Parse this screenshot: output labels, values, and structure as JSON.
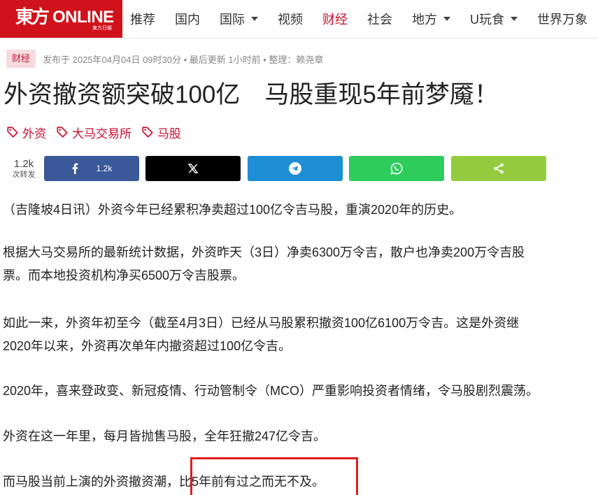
{
  "header": {
    "logo": {
      "cn": "東方",
      "en": "ONLINE",
      "sub": "東方日報"
    },
    "nav": [
      {
        "label": "推荐",
        "dropdown": false,
        "active": false
      },
      {
        "label": "国内",
        "dropdown": false,
        "active": false
      },
      {
        "label": "国际",
        "dropdown": true,
        "active": false
      },
      {
        "label": "视频",
        "dropdown": false,
        "active": false
      },
      {
        "label": "财经",
        "dropdown": false,
        "active": true
      },
      {
        "label": "社会",
        "dropdown": false,
        "active": false
      },
      {
        "label": "地方",
        "dropdown": true,
        "active": false
      },
      {
        "label": "U玩食",
        "dropdown": true,
        "active": false
      },
      {
        "label": "世界万象",
        "dropdown": false,
        "active": false
      }
    ]
  },
  "article": {
    "category": "财经",
    "meta": "发布于 2025年04月04日 09时30分 • 最后更新 1小时前 • 整理：赖尧章",
    "title": "外资撤资额突破100亿　马股重现5年前梦魇！",
    "tags": [
      "外资",
      "大马交易所",
      "马股"
    ],
    "share": {
      "count": "1.2k",
      "count_label": "次转发",
      "facebook_count": "1.2k",
      "buttons": [
        "facebook",
        "x",
        "telegram",
        "whatsapp",
        "share"
      ]
    },
    "paragraphs": [
      [
        "（吉隆坡4日讯）外资今年已经累积净卖超过100亿令吉马股，重演2020年的历史。"
      ],
      [
        "根据大马交易所的最新统计数据，外资昨天（3日）净卖6300万令吉，散户也净卖200万令吉股",
        "票。而本地投资机构净买6500万令吉股票。"
      ],
      [
        "如此一来，外资年初至今（截至4月3日）已经从马股累积撤资100亿6100万令吉。这是外资继",
        "2020年以来，外资再次单年内撤资超过100亿令吉。"
      ],
      [
        "2020年，喜来登政变、新冠疫情、行动管制令（MCO）严重影响投资者情绪，令马股剧烈震荡。"
      ],
      [
        "外资在这一年里，每月皆抛售马股，全年狂撤247亿令吉。"
      ],
      [
        "而马股当前上演的外资撤资潮，比5年前有过之而无不及。"
      ]
    ]
  },
  "colors": {
    "brand_red": "#d0121b",
    "accent_red": "#c8102e",
    "facebook": "#3b5998",
    "x": "#000000",
    "telegram": "#1d8ed4",
    "whatsapp": "#2ecc5b",
    "share": "#95cc3f",
    "annotation_box": "#e01e1e"
  }
}
